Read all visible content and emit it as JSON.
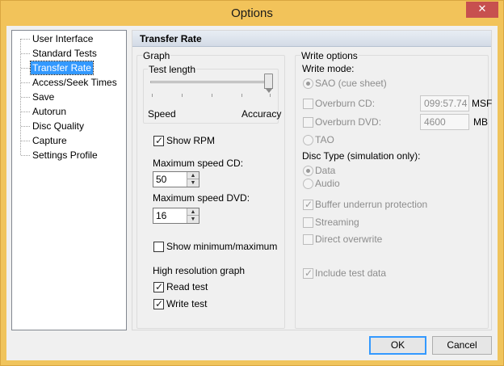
{
  "window": {
    "title": "Options",
    "close_glyph": "✕"
  },
  "nav": {
    "items": [
      {
        "label": "User Interface",
        "selected": false
      },
      {
        "label": "Standard Tests",
        "selected": false
      },
      {
        "label": "Transfer Rate",
        "selected": true
      },
      {
        "label": "Access/Seek Times",
        "selected": false
      },
      {
        "label": "Save",
        "selected": false
      },
      {
        "label": "Autorun",
        "selected": false
      },
      {
        "label": "Disc Quality",
        "selected": false
      },
      {
        "label": "Capture",
        "selected": false
      },
      {
        "label": "Settings Profile",
        "selected": false
      }
    ]
  },
  "panel": {
    "title": "Transfer Rate",
    "graph": {
      "legend": "Graph",
      "test_length": {
        "legend": "Test length",
        "min_label": "Speed",
        "max_label": "Accuracy",
        "value_fraction": 1.0
      },
      "show_rpm": {
        "label": "Show RPM",
        "checked": true
      },
      "max_speed_cd": {
        "label": "Maximum speed CD:",
        "value": "50"
      },
      "max_speed_dvd": {
        "label": "Maximum speed DVD:",
        "value": "16"
      },
      "show_minmax": {
        "label": "Show minimum/maximum",
        "checked": false
      },
      "high_res": {
        "legend": "High resolution graph",
        "read_test": {
          "label": "Read test",
          "checked": true
        },
        "write_test": {
          "label": "Write test",
          "checked": true
        }
      }
    },
    "write_options": {
      "legend": "Write options",
      "write_mode_label": "Write mode:",
      "sao": {
        "label": "SAO (cue sheet)",
        "selected": true
      },
      "overburn_cd": {
        "label": "Overburn CD:",
        "value": "099:57.74",
        "unit": "MSF"
      },
      "overburn_dvd": {
        "label": "Overburn DVD:",
        "value": "4600",
        "unit": "MB"
      },
      "tao": {
        "label": "TAO",
        "selected": false
      },
      "disc_type_label": "Disc Type (simulation only):",
      "data": {
        "label": "Data",
        "selected": true
      },
      "audio": {
        "label": "Audio",
        "selected": false
      },
      "buffer_underrun": {
        "label": "Buffer underrun protection",
        "checked": true
      },
      "streaming": {
        "label": "Streaming",
        "checked": false
      },
      "direct_overwrite": {
        "label": "Direct overwrite",
        "checked": false
      },
      "include_test_data": {
        "label": "Include test data",
        "checked": true
      }
    }
  },
  "footer": {
    "ok_label": "OK",
    "cancel_label": "Cancel"
  },
  "colors": {
    "title_bar": "#f2c35a",
    "selection": "#3399ff",
    "close_button": "#c7504f"
  },
  "icons": {
    "check": "check-icon",
    "spin_up": "arrow-up-icon",
    "spin_down": "arrow-down-icon"
  }
}
